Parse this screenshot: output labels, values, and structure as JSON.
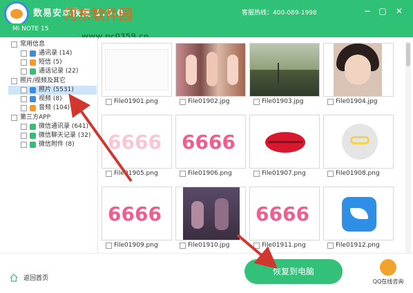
{
  "window": {
    "title": "数易安卓恢复 1.0.0",
    "device": "Mi NOTE 15",
    "hotline": "客服热线：400-089-1998",
    "watermark": "河东软件园",
    "watermark_url": "www.pc0359.cn",
    "min_icon": "minimize-icon",
    "max_icon": "maximize-icon",
    "close_icon": "close-icon"
  },
  "sidebar": {
    "groups": [
      {
        "label": "常用信息",
        "items": [
          {
            "label": "通讯录 (14)",
            "icon": "contacts-icon",
            "color": "#3a8de0"
          },
          {
            "label": "短信 (5)",
            "icon": "sms-icon",
            "color": "#f29a2e"
          },
          {
            "label": "通话记录 (22)",
            "icon": "call-log-icon",
            "color": "#2fc176"
          }
        ]
      },
      {
        "label": "照片/视频及其它",
        "items": [
          {
            "label": "照片 (5531)",
            "icon": "photo-icon",
            "color": "#3a8de0",
            "selected": true
          },
          {
            "label": "视频 (8)",
            "icon": "video-icon",
            "color": "#3a8de0"
          },
          {
            "label": "音频 (104)",
            "icon": "audio-icon",
            "color": "#f29a2e"
          }
        ]
      },
      {
        "label": "第三方APP",
        "items": [
          {
            "label": "微信通讯录 (641)",
            "icon": "wechat-icon",
            "color": "#2fc176"
          },
          {
            "label": "微信聊天记录 (32)",
            "icon": "wechat-icon",
            "color": "#2fc176"
          },
          {
            "label": "微信附件 (8)",
            "icon": "wechat-icon",
            "color": "#2fc176"
          }
        ]
      }
    ]
  },
  "files": [
    {
      "name": "File01901.png"
    },
    {
      "name": "File01902.jpg"
    },
    {
      "name": "File01903.jpg"
    },
    {
      "name": "File01904.jpg"
    },
    {
      "name": "File01905.png",
      "text": "6666"
    },
    {
      "name": "File01906.png",
      "text": "6666"
    },
    {
      "name": "File01907.png"
    },
    {
      "name": "File01908.png"
    },
    {
      "name": "File01909.png",
      "text": "6666"
    },
    {
      "name": "File01910.jpg"
    },
    {
      "name": "File01911.png",
      "text": "6666"
    },
    {
      "name": "File01912.png"
    }
  ],
  "bottom": {
    "home_label": "返回首页",
    "recover_label": "恢复到电脑",
    "qq_label": "QQ在线咨询"
  },
  "colors": {
    "accent": "#2fc176",
    "arrow": "#d1362f"
  }
}
